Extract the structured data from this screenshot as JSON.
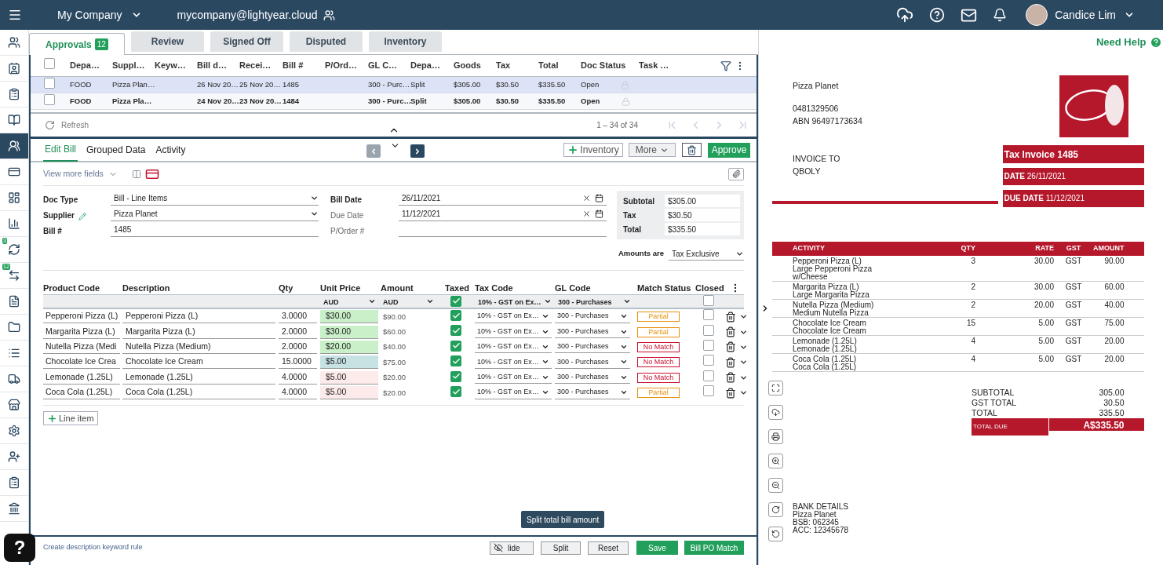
{
  "top_bar": {
    "company": "My Company",
    "email": "mycompany@lightyear.cloud",
    "user": "Candice Lim"
  },
  "sidebar": [
    {
      "kind": "users",
      "selected": false
    },
    {
      "kind": "contact",
      "selected": false
    },
    {
      "kind": "clipboard",
      "selected": false
    },
    {
      "kind": "book",
      "selected": false
    },
    {
      "kind": "people",
      "selected": true
    },
    {
      "kind": "card",
      "selected": false
    },
    {
      "kind": "dashboard",
      "selected": false
    },
    {
      "kind": "chart",
      "selected": false
    },
    {
      "kind": "sync",
      "selected": false,
      "badge": "3"
    },
    {
      "kind": "transfer",
      "selected": false,
      "badge": "12"
    },
    {
      "kind": "po",
      "selected": false
    },
    {
      "kind": "folder",
      "selected": false
    },
    {
      "kind": "list",
      "selected": false
    },
    {
      "kind": "truck",
      "selected": false
    },
    {
      "kind": "store",
      "selected": false
    },
    {
      "kind": "settings",
      "selected": false
    },
    {
      "kind": "user_add",
      "selected": false
    },
    {
      "kind": "clipboard",
      "selected": false
    },
    {
      "kind": "bank",
      "selected": false
    }
  ],
  "help_button": "?",
  "tabs": [
    {
      "label": "Approvals",
      "badge": "12",
      "selected": true
    },
    {
      "label": "Review",
      "selected": false
    },
    {
      "label": "Signed Off",
      "selected": false
    },
    {
      "label": "Disputed",
      "selected": false
    },
    {
      "label": "Inventory",
      "selected": false
    }
  ],
  "need_help": "Need Help",
  "table": {
    "select_all_checked": false,
    "columns": [
      "Depa…",
      "Suppl…",
      "Keyw…",
      "Bill d…",
      "Recei…",
      "Bill #",
      "P/Ord…",
      "GL C…",
      "Depa…",
      "Goods",
      "Tax",
      "Total",
      "Doc Status",
      "Task …"
    ],
    "rows": [
      {
        "selected": true,
        "checked": false,
        "unread": false,
        "cells": [
          "FOOD",
          "Pizza Plan…",
          "",
          "26 Nov 20…",
          "25 Nov 20…",
          "1485",
          "",
          "300 - Purc…",
          "Split",
          "$305.00",
          "$30.50",
          "$335.50",
          "Open",
          ""
        ]
      },
      {
        "selected": false,
        "checked": false,
        "unread": true,
        "cells": [
          "FOOD",
          "Pizza Pla…",
          "",
          "24 Nov 20…",
          "23 Nov 20…",
          "1484",
          "",
          "300 - Purc…",
          "Split",
          "$305.00",
          "$30.50",
          "$335.50",
          "Open",
          ""
        ]
      }
    ],
    "refresh": "Refresh",
    "pagination": "1 – 34 of 34"
  },
  "edit_tabs": [
    {
      "label": "Edit Bill",
      "selected": true
    },
    {
      "label": "Grouped Data",
      "selected": false
    },
    {
      "label": "Activity",
      "selected": false
    }
  ],
  "actions": {
    "inventory": "Inventory",
    "more": "More",
    "approve": "Approve"
  },
  "view_more": "View more fields",
  "form_left": [
    {
      "label": "Doc Type",
      "value": "Bill - Line Items",
      "kind": "dropdown",
      "required": true
    },
    {
      "label": "Supplier",
      "value": "Pizza Planet",
      "kind": "dropdown",
      "required": true,
      "editable": true
    },
    {
      "label": "Bill #",
      "value": "1485",
      "kind": "text",
      "required": true
    }
  ],
  "form_right": [
    {
      "label": "Bill Date",
      "value": "26/11/2021",
      "kind": "date",
      "required": true
    },
    {
      "label": "Due Date",
      "value": "11/12/2021",
      "kind": "date",
      "required": false
    },
    {
      "label": "P/Order #",
      "kind": "text",
      "required": false
    }
  ],
  "totals": [
    {
      "label": "Subtotal",
      "value": "$305.00"
    },
    {
      "label": "Tax",
      "value": "$30.50"
    },
    {
      "label": "Total",
      "value": "$335.50"
    }
  ],
  "amounts_are": {
    "label": "Amounts are",
    "value": "Tax Exclusive"
  },
  "lines": {
    "columns": [
      "Product Code",
      "Description",
      "Qty",
      "Unit Price",
      "Amount",
      "Taxed",
      "Tax Code",
      "GL Code",
      "Match Status",
      "Closed"
    ],
    "defaults": {
      "unit_currency": "AUD",
      "amount_currency": "AUD",
      "taxed": true,
      "tax_code": "10% - GST on Ex…",
      "gl_code": "300 - Purchases",
      "closed": false
    },
    "rows": [
      {
        "product": "Pepperoni Pizza (L)",
        "description": "Pepperoni Pizza (L)",
        "qty": "3.0000",
        "price": "$30.00",
        "color": "#c9f0c9",
        "amount": "$90.00",
        "taxed": true,
        "tax_code": "10% - GST on Ex…",
        "gl_code": "300 - Purchases",
        "match": {
          "label": "Partial",
          "kind": "partial"
        },
        "closed": false
      },
      {
        "product": "Margarita Pizza (L)",
        "description": "Margarita Pizza (L)",
        "qty": "2.0000",
        "price": "$30.00",
        "color": "#c9f0c9",
        "amount": "$60.00",
        "taxed": true,
        "tax_code": "10% - GST on Ex…",
        "gl_code": "300 - Purchases",
        "match": {
          "label": "Partial",
          "kind": "partial"
        },
        "closed": false
      },
      {
        "product": "Nutella Pizza (Medi",
        "description": "Nutella Pizza (Medium)",
        "qty": "2.0000",
        "price": "$20.00",
        "color": "#c9f0c9",
        "amount": "$40.00",
        "taxed": true,
        "tax_code": "10% - GST on Ex…",
        "gl_code": "300 - Purchases",
        "match": {
          "label": "No Match",
          "kind": "no_match"
        },
        "closed": false
      },
      {
        "product": "Chocolate Ice Crea",
        "description": "Chocolate Ice Cream",
        "qty": "15.0000",
        "price": "$5.00",
        "color": "#c6e2e2",
        "amount": "$75.00",
        "taxed": true,
        "tax_code": "10% - GST on Ex…",
        "gl_code": "300 - Purchases",
        "match": {
          "label": "No Match",
          "kind": "no_match"
        },
        "closed": false
      },
      {
        "product": "Lemonade (1.25L)",
        "description": "Lemonade (1.25L)",
        "qty": "4.0000",
        "price": "$5.00",
        "color": "#fdeaea",
        "amount": "$20.00",
        "taxed": true,
        "tax_code": "10% - GST on Ex…",
        "gl_code": "300 - Purchases",
        "match": {
          "label": "No Match",
          "kind": "no_match"
        },
        "closed": false
      },
      {
        "product": "Coca Cola (1.25L)",
        "description": "Coca Cola (1.25L)",
        "qty": "4.0000",
        "price": "$5.00",
        "color": "#fdeaea",
        "amount": "$20.00",
        "taxed": true,
        "tax_code": "10% - GST on Ex…",
        "gl_code": "300 - Purchases",
        "match": {
          "label": "Partial",
          "kind": "partial"
        },
        "closed": false
      }
    ],
    "add_line": "Line item"
  },
  "footer": {
    "link": "Create description keyword rule",
    "hide": "lide",
    "split": "Split",
    "reset": "Reset",
    "save": "Save",
    "po_match": "Bill PO Match",
    "tooltip": "Split total bill amount"
  },
  "invoice": {
    "supplier": "Pizza Planet",
    "phone": "0481329506",
    "abn": "ABN 96497173634",
    "invoice_to": "INVOICE TO",
    "customer": "QBOLY",
    "title": "Tax Invoice 1485",
    "date": "**DATE** 26/11/2021",
    "due_date": "**DUE DATE** 11/12/2021",
    "columns": [
      "ACTIVITY",
      "QTY",
      "RATE",
      "GST",
      "AMOUNT"
    ],
    "rows": [
      {
        "name": "Pepperoni Pizza (L)",
        "detail": "Large Pepperoni Pizza w/Cheese",
        "qty": "3",
        "rate": "30.00",
        "gst": "GST",
        "amount": "90.00"
      },
      {
        "name": "Margarita Pizza (L)",
        "detail": "Large Margarita Pizza",
        "qty": "2",
        "rate": "30.00",
        "gst": "GST",
        "amount": "60.00"
      },
      {
        "name": "Nutella Pizza (Medium)",
        "detail": "Medium Nutella Pizza",
        "qty": "2",
        "rate": "20.00",
        "gst": "GST",
        "amount": "40.00"
      },
      {
        "name": "Chocolate Ice Cream",
        "detail": "Chocolate Ice Cream",
        "qty": "15",
        "rate": "5.00",
        "gst": "GST",
        "amount": "75.00"
      },
      {
        "name": "Lemonade (1.25L)",
        "detail": "Lemonade (1.25L)",
        "qty": "4",
        "rate": "5.00",
        "gst": "GST",
        "amount": "20.00"
      },
      {
        "name": "Coca Cola (1.25L)",
        "detail": "Coca Cola (1.25L)",
        "qty": "4",
        "rate": "5.00",
        "gst": "GST",
        "amount": "20.00"
      }
    ],
    "totals": [
      {
        "label": "SUBTOTAL",
        "value": "305.00"
      },
      {
        "label": "GST TOTAL",
        "value": "30.50"
      },
      {
        "label": "TOTAL",
        "value": "335.50"
      }
    ],
    "total_due": {
      "label": "TOTAL DUE",
      "value": "A$335.50"
    },
    "bank": [
      "BANK DETAILS",
      "Pizza Planet",
      "BSB: 062345",
      "ACC: 12345678"
    ]
  }
}
